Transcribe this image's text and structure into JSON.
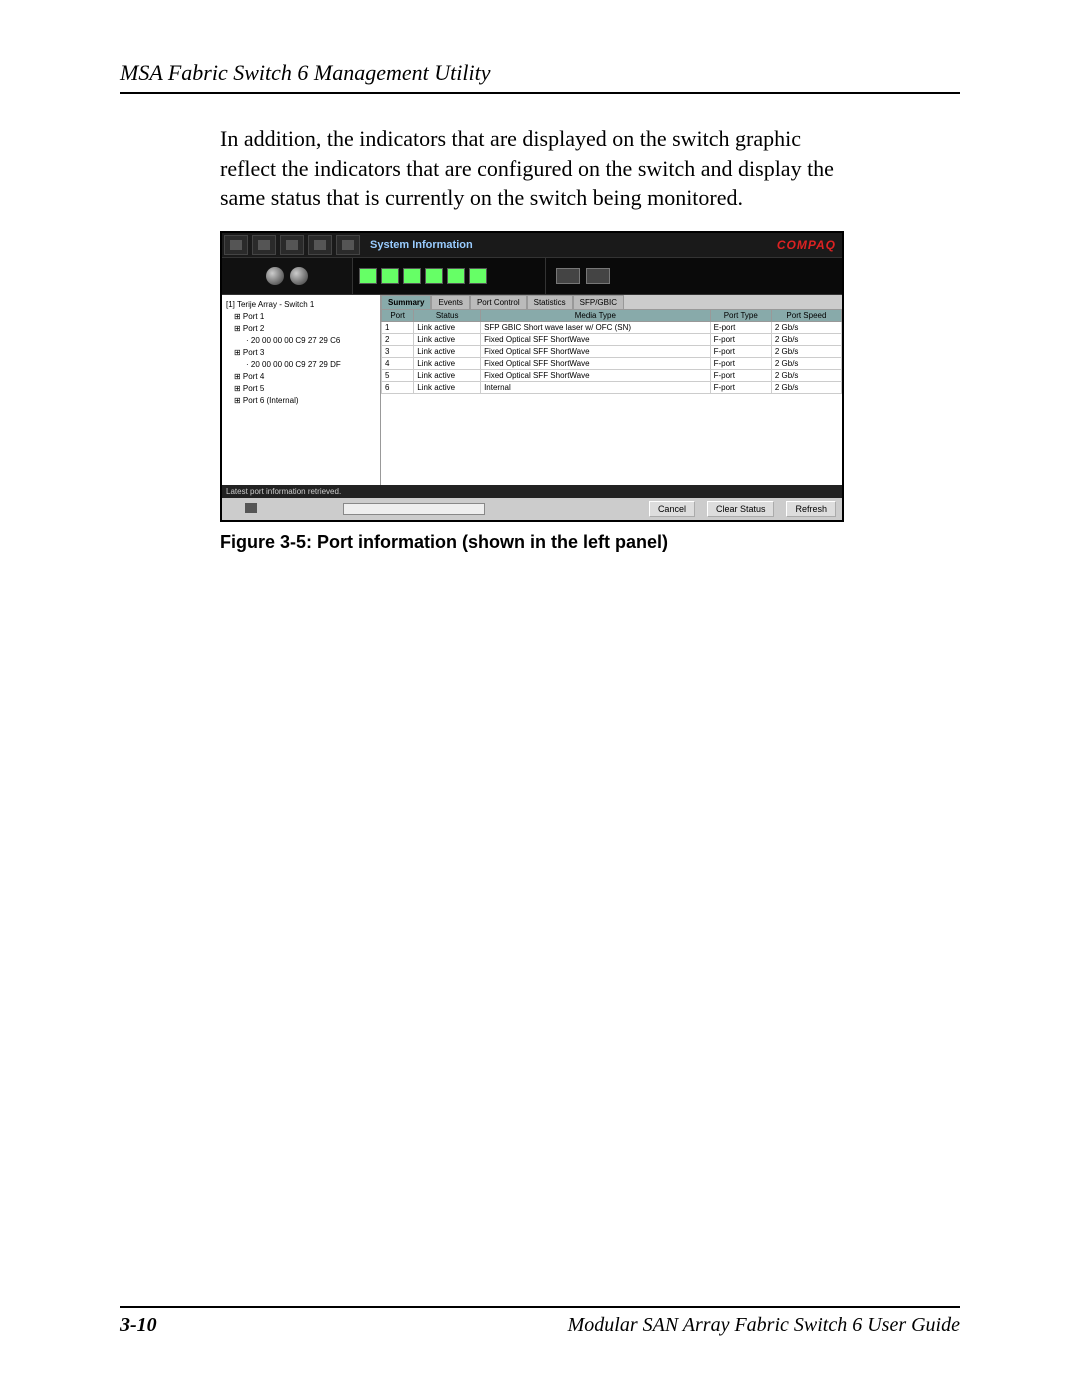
{
  "running_head": "MSA Fabric Switch 6 Management Utility",
  "paragraph": "In addition, the indicators that are displayed on the switch graphic reflect the indicators that are configured on the switch and display the same status that is currently on the switch being monitored.",
  "caption": "Figure 3-5:  Port information (shown in the left panel)",
  "page_number": "3-10",
  "footer_title": "Modular SAN Array Fabric Switch 6 User Guide",
  "app": {
    "title": "System Information",
    "brand": "COMPAQ",
    "tree_root": "[1] Terije Array - Switch 1",
    "tree": [
      {
        "label": "Port 1",
        "lvl": 1
      },
      {
        "label": "Port 2",
        "lvl": 1
      },
      {
        "label": "20 00 00 00 C9 27 29 C6",
        "lvl": 2
      },
      {
        "label": "Port 3",
        "lvl": 1
      },
      {
        "label": "20 00 00 00 C9 27 29 DF",
        "lvl": 2
      },
      {
        "label": "Port 4",
        "lvl": 1
      },
      {
        "label": "Port 5",
        "lvl": 1
      },
      {
        "label": "Port 6 (Internal)",
        "lvl": 1
      }
    ],
    "tabs": [
      "Summary",
      "Events",
      "Port Control",
      "Statistics",
      "SFP/GBIC"
    ],
    "active_tab": 0,
    "columns": [
      "Port",
      "Status",
      "Media Type",
      "Port Type",
      "Port Speed"
    ],
    "rows": [
      {
        "port": "1",
        "status": "Link active",
        "media": "SFP GBIC Short wave laser w/ OFC (SN)",
        "ptype": "E-port",
        "speed": "2 Gb/s"
      },
      {
        "port": "2",
        "status": "Link active",
        "media": "Fixed Optical SFF ShortWave",
        "ptype": "F-port",
        "speed": "2 Gb/s"
      },
      {
        "port": "3",
        "status": "Link active",
        "media": "Fixed Optical SFF ShortWave",
        "ptype": "F-port",
        "speed": "2 Gb/s"
      },
      {
        "port": "4",
        "status": "Link active",
        "media": "Fixed Optical SFF ShortWave",
        "ptype": "F-port",
        "speed": "2 Gb/s"
      },
      {
        "port": "5",
        "status": "Link active",
        "media": "Fixed Optical SFF ShortWave",
        "ptype": "F-port",
        "speed": "2 Gb/s"
      },
      {
        "port": "6",
        "status": "Link active",
        "media": "Internal",
        "ptype": "F-port",
        "speed": "2 Gb/s"
      }
    ],
    "status_text": "Latest port information retrieved.",
    "buttons": {
      "cancel": "Cancel",
      "clear": "Clear Status",
      "refresh": "Refresh"
    }
  },
  "chart_data": {
    "type": "table",
    "title": "Port information summary",
    "columns": [
      "Port",
      "Status",
      "Media Type",
      "Port Type",
      "Port Speed"
    ],
    "rows": [
      [
        "1",
        "Link active",
        "SFP GBIC Short wave laser w/ OFC (SN)",
        "E-port",
        "2 Gb/s"
      ],
      [
        "2",
        "Link active",
        "Fixed Optical SFF ShortWave",
        "F-port",
        "2 Gb/s"
      ],
      [
        "3",
        "Link active",
        "Fixed Optical SFF ShortWave",
        "F-port",
        "2 Gb/s"
      ],
      [
        "4",
        "Link active",
        "Fixed Optical SFF ShortWave",
        "F-port",
        "2 Gb/s"
      ],
      [
        "5",
        "Link active",
        "Fixed Optical SFF ShortWave",
        "F-port",
        "2 Gb/s"
      ],
      [
        "6",
        "Link active",
        "Internal",
        "F-port",
        "2 Gb/s"
      ]
    ]
  }
}
